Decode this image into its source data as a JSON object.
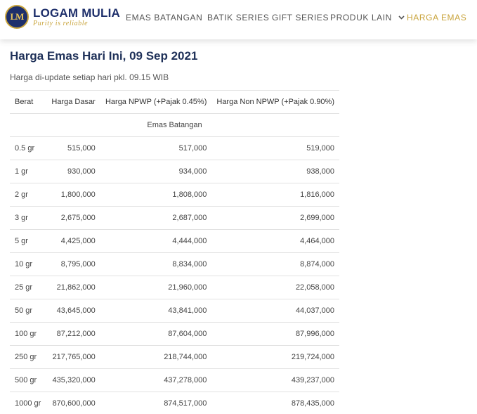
{
  "brand": {
    "badge": "LM",
    "name": "LOGAM MULIA",
    "tagline": "Purity is reliable",
    "colors": {
      "navy": "#1e2f6b",
      "gold": "#c9a43c"
    }
  },
  "nav": {
    "items": [
      {
        "label": "EMAS BATANGAN"
      },
      {
        "label": "BATIK SERIES"
      },
      {
        "label": "GIFT SERIES"
      },
      {
        "label": "PRODUK LAIN",
        "dropdown_icon": "chevron-down-icon"
      },
      {
        "label": "HARGA EMAS",
        "active": true
      }
    ]
  },
  "page": {
    "title": "Harga Emas Hari Ini, 09 Sep 2021",
    "subtitle": "Harga di-update setiap hari pkl. 09.15 WIB"
  },
  "table": {
    "headers": [
      "Berat",
      "Harga Dasar",
      "Harga NPWP (+Pajak 0.45%)",
      "Harga Non NPWP (+Pajak 0.90%)"
    ],
    "section": "Emas Batangan",
    "rows": [
      [
        "0.5 gr",
        "515,000",
        "517,000",
        "519,000"
      ],
      [
        "1 gr",
        "930,000",
        "934,000",
        "938,000"
      ],
      [
        "2 gr",
        "1,800,000",
        "1,808,000",
        "1,816,000"
      ],
      [
        "3 gr",
        "2,675,000",
        "2,687,000",
        "2,699,000"
      ],
      [
        "5 gr",
        "4,425,000",
        "4,444,000",
        "4,464,000"
      ],
      [
        "10 gr",
        "8,795,000",
        "8,834,000",
        "8,874,000"
      ],
      [
        "25 gr",
        "21,862,000",
        "21,960,000",
        "22,058,000"
      ],
      [
        "50 gr",
        "43,645,000",
        "43,841,000",
        "44,037,000"
      ],
      [
        "100 gr",
        "87,212,000",
        "87,604,000",
        "87,996,000"
      ],
      [
        "250 gr",
        "217,765,000",
        "218,744,000",
        "219,724,000"
      ],
      [
        "500 gr",
        "435,320,000",
        "437,278,000",
        "439,237,000"
      ],
      [
        "1000 gr",
        "870,600,000",
        "874,517,000",
        "878,435,000"
      ]
    ]
  }
}
